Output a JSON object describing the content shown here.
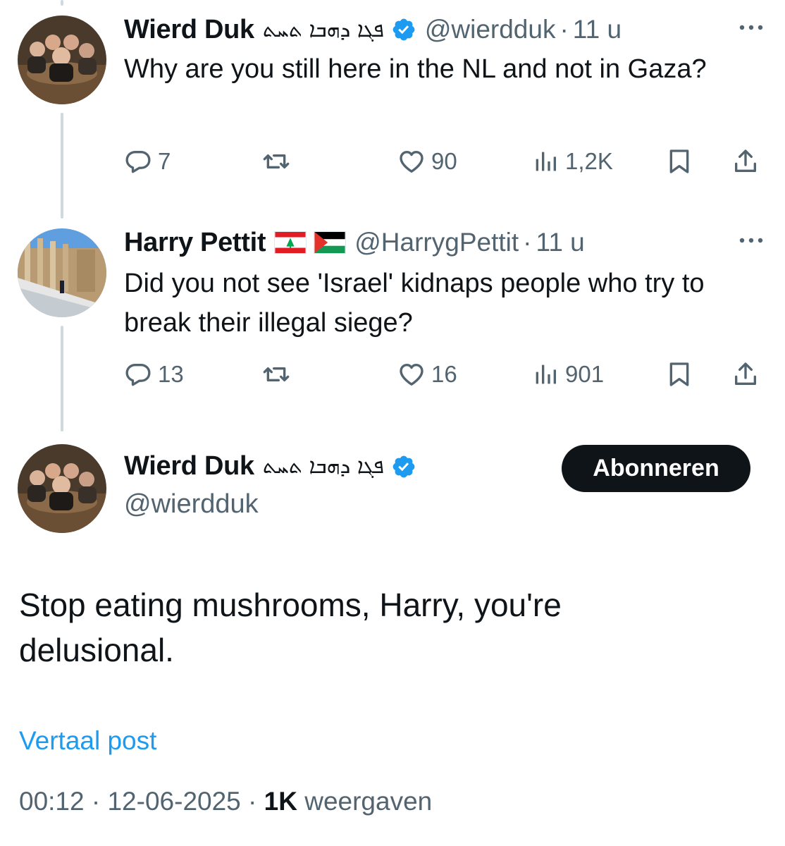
{
  "thread": [
    {
      "name": "Wierd Duk",
      "script_name": "ܦܓܐ ܕܗܒܐ ܬܚܬ",
      "verified": true,
      "flags": [],
      "handle": "@wierdduk",
      "time": "11 u",
      "text": "Why are you still here in the NL and not in Gaza?",
      "replies": "7",
      "reposts": "",
      "likes": "90",
      "views": "1,2K"
    },
    {
      "name": "Harry Pettit",
      "script_name": "",
      "verified": false,
      "flags": [
        "lebanon-flag",
        "palestine-flag"
      ],
      "handle": "@HarrygPettit",
      "time": "11 u",
      "text": "Did you not see 'Israel' kidnaps people who try to break their illegal siege?",
      "replies": "13",
      "reposts": "",
      "likes": "16",
      "views": "901"
    }
  ],
  "main_post": {
    "name": "Wierd Duk",
    "script_name": "ܦܓܐ ܕܗܒܐ ܬܚܬ",
    "handle": "@wierdduk",
    "follow_label": "Abonneren",
    "text": "Stop eating mushrooms, Harry, you're delusional.",
    "translate_label": "Vertaal post",
    "time": "00:12",
    "date": "12-06-2025",
    "views_count": "1K",
    "views_label": "weergaven"
  },
  "colors": {
    "text": "#0f1419",
    "secondary": "#536471",
    "link": "#1d9bf0",
    "verified": "#1d9bf0",
    "thread_line": "#cfd9de",
    "button_bg": "#0f1419"
  },
  "icons": [
    "reply-icon",
    "repost-icon",
    "like-icon",
    "views-icon",
    "bookmark-icon",
    "share-icon",
    "more-icon",
    "verified-icon"
  ]
}
